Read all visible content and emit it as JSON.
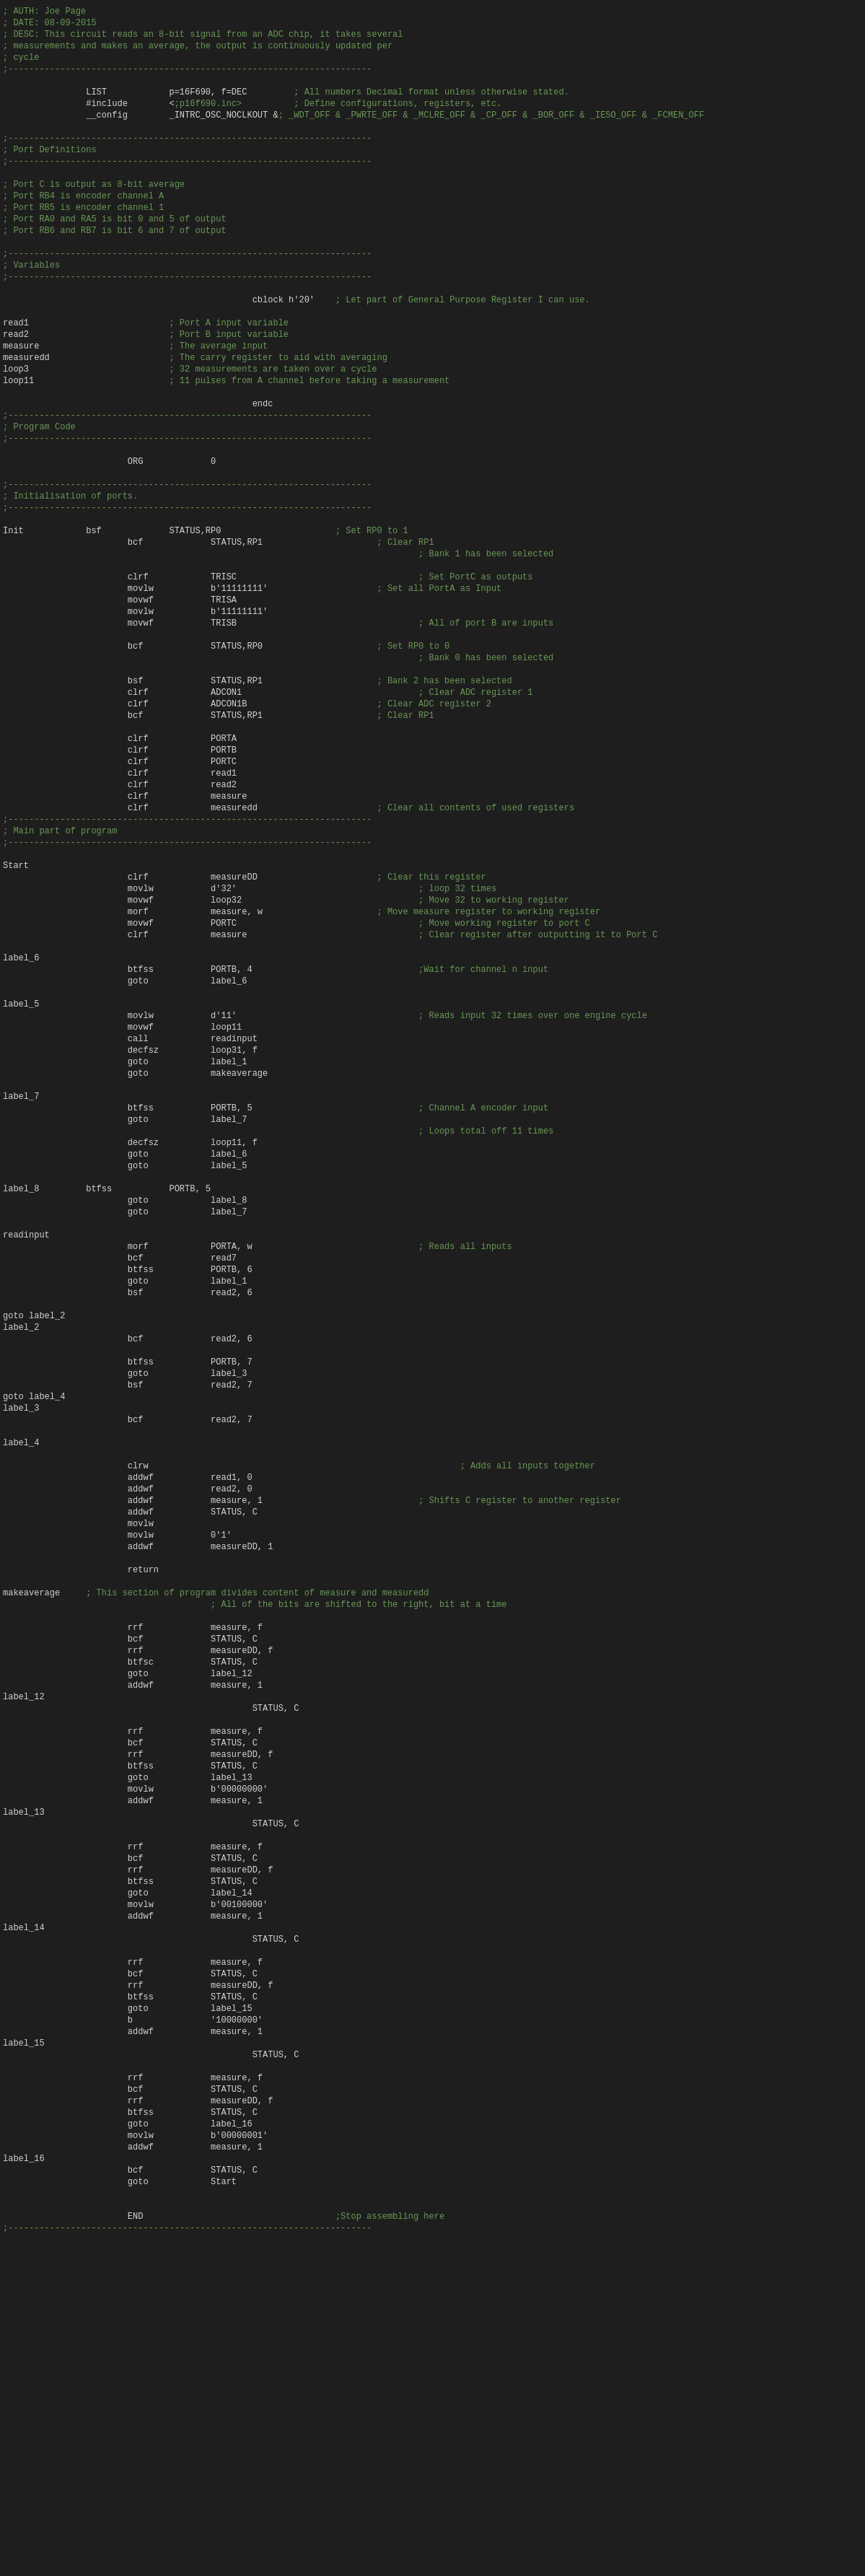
{
  "lines": [
    {
      "num": "",
      "content": "; AUTH: Joe Page",
      "class": "comment"
    },
    {
      "num": "",
      "content": "; DATE: 08-09-2015",
      "class": "comment"
    },
    {
      "num": "",
      "content": "; DESC: This circuit reads an 8-bit signal from an ADC chip, it takes several",
      "class": "comment"
    },
    {
      "num": "",
      "content": "; measurements and makes an average, the output is continuously updated per",
      "class": "comment"
    },
    {
      "num": "",
      "content": "; cycle",
      "class": "comment"
    },
    {
      "num": "",
      "content": ";----------------------------------------------------------------------",
      "class": "separator"
    },
    {
      "num": "",
      "content": "",
      "class": "normal"
    },
    {
      "num": "",
      "content": "\t\tLIST\t\tp=16F690, f=DEC\t\t; All numbers Decimal format unless otherwise stated.",
      "class": "normal"
    },
    {
      "num": "",
      "content": "\t\t#include\t<p16f690.inc>\t\t; Define configurations, registers, etc.",
      "class": "normal"
    },
    {
      "num": "",
      "content": "\t\t__config\t_INTRC_OSC_NOCLKOUT & _WDT_OFF & _PWRTE_OFF & _MCLRE_OFF & _CP_OFF & _BOR_OFF & _IESO_OFF & _FCMEN_OFF",
      "class": "normal"
    },
    {
      "num": "",
      "content": "",
      "class": "normal"
    },
    {
      "num": "",
      "content": ";----------------------------------------------------------------------",
      "class": "separator"
    },
    {
      "num": "",
      "content": "; Port Definitions",
      "class": "comment"
    },
    {
      "num": "",
      "content": ";----------------------------------------------------------------------",
      "class": "separator"
    },
    {
      "num": "",
      "content": "",
      "class": "normal"
    },
    {
      "num": "",
      "content": "; Port C is output as 8-bit average",
      "class": "comment"
    },
    {
      "num": "",
      "content": "; Port RB4 is encoder channel A",
      "class": "comment"
    },
    {
      "num": "",
      "content": "; Port RB5 is encoder channel 1",
      "class": "comment"
    },
    {
      "num": "",
      "content": "; Port RA0 and RA5 is bit 0 and 5 of output",
      "class": "comment"
    },
    {
      "num": "",
      "content": "; Port RB6 and RB7 is bit 6 and 7 of output",
      "class": "comment"
    },
    {
      "num": "",
      "content": "",
      "class": "normal"
    },
    {
      "num": "",
      "content": ";----------------------------------------------------------------------",
      "class": "separator"
    },
    {
      "num": "",
      "content": "; Variables",
      "class": "comment"
    },
    {
      "num": "",
      "content": ";----------------------------------------------------------------------",
      "class": "separator"
    },
    {
      "num": "",
      "content": "",
      "class": "normal"
    },
    {
      "num": "",
      "content": "\t\t\t\t\t\tcblock h'20'\t; Let part of General Purpose Register I can use.",
      "class": "normal"
    },
    {
      "num": "",
      "content": "",
      "class": "normal"
    },
    {
      "num": "",
      "content": "read1\t\t\t\t; Port A input variable",
      "class": "normal"
    },
    {
      "num": "",
      "content": "read2\t\t\t\t; Port B input variable",
      "class": "normal"
    },
    {
      "num": "",
      "content": "measure\t\t\t\t; The average input",
      "class": "normal"
    },
    {
      "num": "",
      "content": "measuredd\t\t\t; The carry register to aid with averaging",
      "class": "normal"
    },
    {
      "num": "",
      "content": "loop3\t\t\t\t; 32 measurements are taken over a cycle",
      "class": "normal"
    },
    {
      "num": "",
      "content": "loop11\t\t\t\t; 11 pulses from A channel before taking a measurement",
      "class": "normal"
    },
    {
      "num": "",
      "content": "",
      "class": "normal"
    },
    {
      "num": "",
      "content": "\t\t\t\t\t\tendc",
      "class": "normal"
    },
    {
      "num": "",
      "content": ";----------------------------------------------------------------------",
      "class": "separator"
    },
    {
      "num": "",
      "content": "; Program Code",
      "class": "comment"
    },
    {
      "num": "",
      "content": ";----------------------------------------------------------------------",
      "class": "separator"
    },
    {
      "num": "",
      "content": "",
      "class": "normal"
    },
    {
      "num": "",
      "content": "\t\t\tORG\t\t0",
      "class": "normal"
    },
    {
      "num": "",
      "content": "",
      "class": "normal"
    },
    {
      "num": "",
      "content": ";----------------------------------------------------------------------",
      "class": "separator"
    },
    {
      "num": "",
      "content": "; Initialisation of ports.",
      "class": "comment"
    },
    {
      "num": "",
      "content": ";----------------------------------------------------------------------",
      "class": "separator"
    },
    {
      "num": "",
      "content": "",
      "class": "normal"
    },
    {
      "num": "",
      "content": "Init\t\tbsf\t\tSTATUS,RP0\t\t\t; Set RP0 to 1",
      "class": "normal"
    },
    {
      "num": "",
      "content": "\t\t\tbcf\t\tSTATUS,RP1\t\t\t; Clear RP1",
      "class": "normal"
    },
    {
      "num": "",
      "content": "\t\t\t\t\t\t\t\t\t\t; Bank 1 has been selected",
      "class": "comment"
    },
    {
      "num": "",
      "content": "",
      "class": "normal"
    },
    {
      "num": "",
      "content": "\t\t\tclrf\t\tTRISC\t\t\t\t\t; Set PortC as outputs",
      "class": "normal"
    },
    {
      "num": "",
      "content": "\t\t\tmovlw\t\tb'11111111'\t\t\t; Set all PortA as Input",
      "class": "normal"
    },
    {
      "num": "",
      "content": "\t\t\tmovwf\t\tTRISA\t",
      "class": "normal"
    },
    {
      "num": "",
      "content": "\t\t\tmovlw\t\tb'11111111'\t",
      "class": "normal"
    },
    {
      "num": "",
      "content": "\t\t\tmovwf\t\tTRISB\t\t\t\t\t; All of port B are inputs",
      "class": "normal"
    },
    {
      "num": "",
      "content": "",
      "class": "normal"
    },
    {
      "num": "",
      "content": "\t\t\tbcf\t\tSTATUS,RP0\t\t\t; Set RP0 to 0",
      "class": "normal"
    },
    {
      "num": "",
      "content": "\t\t\t\t\t\t\t\t\t\t; Bank 0 has been selected",
      "class": "comment"
    },
    {
      "num": "",
      "content": "",
      "class": "normal"
    },
    {
      "num": "",
      "content": "\t\t\tbsf\t\tSTATUS,RP1\t\t\t; Bank 2 has been selected",
      "class": "normal"
    },
    {
      "num": "",
      "content": "\t\t\tclrf\t\tADCON1\t\t\t\t\t; Clear ADC register 1",
      "class": "normal"
    },
    {
      "num": "",
      "content": "\t\t\tclrf\t\tADCON1B\t\t\t\t; Clear ADC register 2",
      "class": "normal"
    },
    {
      "num": "",
      "content": "\t\t\tbcf\t\tSTATUS,RP1\t\t\t; Clear RP1",
      "class": "normal"
    },
    {
      "num": "",
      "content": "",
      "class": "normal"
    },
    {
      "num": "",
      "content": "\t\t\tclrf\t\tPORTA",
      "class": "normal"
    },
    {
      "num": "",
      "content": "\t\t\tclrf\t\tPORTB",
      "class": "normal"
    },
    {
      "num": "",
      "content": "\t\t\tclrf\t\tPORTC",
      "class": "normal"
    },
    {
      "num": "",
      "content": "\t\t\tclrf\t\tread1",
      "class": "normal"
    },
    {
      "num": "",
      "content": "\t\t\tclrf\t\tread2",
      "class": "normal"
    },
    {
      "num": "",
      "content": "\t\t\tclrf\t\tmeasure",
      "class": "normal"
    },
    {
      "num": "",
      "content": "\t\t\tclrf\t\tmeasuredd\t\t\t; Clear all contents of used registers",
      "class": "normal"
    },
    {
      "num": "",
      "content": ";----------------------------------------------------------------------",
      "class": "separator"
    },
    {
      "num": "",
      "content": "; Main part of program",
      "class": "comment"
    },
    {
      "num": "",
      "content": ";----------------------------------------------------------------------",
      "class": "separator"
    },
    {
      "num": "",
      "content": "",
      "class": "normal"
    },
    {
      "num": "",
      "content": "Start",
      "class": "label"
    },
    {
      "num": "",
      "content": "\t\t\tclrf\t\tmeasureDD\t\t\t; Clear this register",
      "class": "normal"
    },
    {
      "num": "",
      "content": "\t\t\tmovlw\t\td'32'\t\t\t\t\t; loop 32 times",
      "class": "normal"
    },
    {
      "num": "",
      "content": "\t\t\tmovwf\t\tloop32\t\t\t\t\t; Move 32 to working register",
      "class": "normal"
    },
    {
      "num": "",
      "content": "\t\t\tmorf\t\tmeasure, w\t\t\t; Move measure register to working register",
      "class": "normal"
    },
    {
      "num": "",
      "content": "\t\t\tmovwf\t\tPORTC\t\t\t\t\t; Move working register to port C",
      "class": "normal"
    },
    {
      "num": "",
      "content": "\t\t\tclrf\t\tmeasure\t\t\t\t\t; Clear register after outputting it to Port C",
      "class": "normal"
    },
    {
      "num": "",
      "content": "",
      "class": "normal"
    },
    {
      "num": "",
      "content": "label_6",
      "class": "label"
    },
    {
      "num": "",
      "content": "\t\t\tbtfss\t\tPORTB, 4\t\t\t\t;Wait for channel n input",
      "class": "normal"
    },
    {
      "num": "",
      "content": "\t\t\tgoto\t\tlabel_6",
      "class": "normal"
    },
    {
      "num": "",
      "content": "",
      "class": "normal"
    },
    {
      "num": "",
      "content": "label_5",
      "class": "label"
    },
    {
      "num": "",
      "content": "\t\t\tmovlw\t\td'11'\t\t\t\t\t; Reads input 32 times over one engine cycle",
      "class": "normal"
    },
    {
      "num": "",
      "content": "\t\t\tmovwf\t\tloop11",
      "class": "normal"
    },
    {
      "num": "",
      "content": "\t\t\tcall\t\treadinput",
      "class": "normal"
    },
    {
      "num": "",
      "content": "\t\t\tdecfsz\t\tloop31, f",
      "class": "normal"
    },
    {
      "num": "",
      "content": "\t\t\tgoto\t\tlabel_1",
      "class": "normal"
    },
    {
      "num": "",
      "content": "\t\t\tgoto\t\tmakeaverage",
      "class": "normal"
    },
    {
      "num": "",
      "content": "",
      "class": "normal"
    },
    {
      "num": "",
      "content": "label_7",
      "class": "label"
    },
    {
      "num": "",
      "content": "\t\t\tbtfss\t\tPORTB, 5\t\t\t\t; Channel A encoder input",
      "class": "normal"
    },
    {
      "num": "",
      "content": "\t\t\tgoto\t\tlabel_7",
      "class": "normal"
    },
    {
      "num": "",
      "content": "\t\t\t\t\t\t\t\t\t\t; Loops total off 11 times",
      "class": "comment"
    },
    {
      "num": "",
      "content": "\t\t\tdecfsz\t\tloop11, f",
      "class": "normal"
    },
    {
      "num": "",
      "content": "\t\t\tgoto\t\tlabel_6",
      "class": "normal"
    },
    {
      "num": "",
      "content": "\t\t\tgoto\t\tlabel_5",
      "class": "normal"
    },
    {
      "num": "",
      "content": "",
      "class": "normal"
    },
    {
      "num": "",
      "content": "label_8\t\tbtfss\t\tPORTB, 5",
      "class": "normal"
    },
    {
      "num": "",
      "content": "\t\t\tgoto\t\tlabel_8",
      "class": "normal"
    },
    {
      "num": "",
      "content": "\t\t\tgoto\t\tlabel_7",
      "class": "normal"
    },
    {
      "num": "",
      "content": "",
      "class": "normal"
    },
    {
      "num": "",
      "content": "readinput",
      "class": "label"
    },
    {
      "num": "",
      "content": "\t\t\tmorf\t\tPORTA, w\t\t\t\t; Reads all inputs",
      "class": "normal"
    },
    {
      "num": "",
      "content": "\t\t\tbcf\t\tread7",
      "class": "normal"
    },
    {
      "num": "",
      "content": "\t\t\tbtfss\t\tPORTB, 6",
      "class": "normal"
    },
    {
      "num": "",
      "content": "\t\t\tgoto\t\tlabel_1",
      "class": "normal"
    },
    {
      "num": "",
      "content": "\t\t\tbsf\t\tread2, 6",
      "class": "normal"
    },
    {
      "num": "",
      "content": "",
      "class": "normal"
    },
    {
      "num": "",
      "content": "goto label_2",
      "class": "normal"
    },
    {
      "num": "",
      "content": "label_2",
      "class": "label"
    },
    {
      "num": "",
      "content": "\t\t\tbcf\t\tread2, 6",
      "class": "normal"
    },
    {
      "num": "",
      "content": "",
      "class": "normal"
    },
    {
      "num": "",
      "content": "\t\t\tbtfss\t\tPORTB, 7",
      "class": "normal"
    },
    {
      "num": "",
      "content": "\t\t\tgoto\t\tlabel_3",
      "class": "normal"
    },
    {
      "num": "",
      "content": "\t\t\tbsf\t\tread2, 7",
      "class": "normal"
    },
    {
      "num": "",
      "content": "goto label_4",
      "class": "normal"
    },
    {
      "num": "",
      "content": "label_3",
      "class": "label"
    },
    {
      "num": "",
      "content": "\t\t\tbcf\t\tread2, 7",
      "class": "normal"
    },
    {
      "num": "",
      "content": "",
      "class": "normal"
    },
    {
      "num": "",
      "content": "label_4",
      "class": "label"
    },
    {
      "num": "",
      "content": "",
      "class": "normal"
    },
    {
      "num": "",
      "content": "\t\t\tclrw\t\t\t\t\t\t\t\t; Adds all inputs together",
      "class": "normal"
    },
    {
      "num": "",
      "content": "\t\t\taddwf\t\tread1, 0",
      "class": "normal"
    },
    {
      "num": "",
      "content": "\t\t\taddwf\t\tread2, 0",
      "class": "normal"
    },
    {
      "num": "",
      "content": "\t\t\taddwf\t\tmeasure, 1\t\t\t\t; Shifts C register to another register",
      "class": "normal"
    },
    {
      "num": "",
      "content": "\t\t\taddwf\t\tSTATUS, C",
      "class": "normal"
    },
    {
      "num": "",
      "content": "\t\t\tmovlw",
      "class": "normal"
    },
    {
      "num": "",
      "content": "\t\t\tmovlw\t\t0'1'",
      "class": "normal"
    },
    {
      "num": "",
      "content": "\t\t\taddwf\t\tmeasureDD, 1",
      "class": "normal"
    },
    {
      "num": "",
      "content": "",
      "class": "normal"
    },
    {
      "num": "",
      "content": "\t\t\treturn",
      "class": "normal"
    },
    {
      "num": "",
      "content": "",
      "class": "normal"
    },
    {
      "num": "",
      "content": "makeaverage\t; This section of program divides content of measure and measuredd",
      "class": "normal"
    },
    {
      "num": "",
      "content": "\t\t\t\t\t; All of the bits are shifted to the right, bit at a time",
      "class": "comment"
    },
    {
      "num": "",
      "content": "",
      "class": "normal"
    },
    {
      "num": "",
      "content": "\t\t\trrf\t\tmeasure, f",
      "class": "normal"
    },
    {
      "num": "",
      "content": "\t\t\tbcf\t\tSTATUS, C",
      "class": "normal"
    },
    {
      "num": "",
      "content": "\t\t\trrf\t\tmeasureDD, f",
      "class": "normal"
    },
    {
      "num": "",
      "content": "\t\t\tbtfsc\t\tSTATUS, C",
      "class": "normal"
    },
    {
      "num": "",
      "content": "\t\t\tgoto\t\tlabel_12",
      "class": "normal"
    },
    {
      "num": "",
      "content": "\t\t\taddwf\t\tmeasure, 1",
      "class": "normal"
    },
    {
      "num": "",
      "content": "label_12",
      "class": "label"
    },
    {
      "num": "",
      "content": "\t\t\t\t\t\tSTATUS, C",
      "class": "normal"
    },
    {
      "num": "",
      "content": "",
      "class": "normal"
    },
    {
      "num": "",
      "content": "\t\t\trrf\t\tmeasure, f",
      "class": "normal"
    },
    {
      "num": "",
      "content": "\t\t\tbcf\t\tSTATUS, C",
      "class": "normal"
    },
    {
      "num": "",
      "content": "\t\t\trrf\t\tmeasureDD, f",
      "class": "normal"
    },
    {
      "num": "",
      "content": "\t\t\tbtfss\t\tSTATUS, C",
      "class": "normal"
    },
    {
      "num": "",
      "content": "\t\t\tgoto\t\tlabel_13",
      "class": "normal"
    },
    {
      "num": "",
      "content": "\t\t\tmovlw\t\tb'00000000'",
      "class": "normal"
    },
    {
      "num": "",
      "content": "\t\t\taddwf\t\tmeasure, 1",
      "class": "normal"
    },
    {
      "num": "",
      "content": "label_13",
      "class": "label"
    },
    {
      "num": "",
      "content": "\t\t\t\t\t\tSTATUS, C",
      "class": "normal"
    },
    {
      "num": "",
      "content": "",
      "class": "normal"
    },
    {
      "num": "",
      "content": "\t\t\trrf\t\tmeasure, f",
      "class": "normal"
    },
    {
      "num": "",
      "content": "\t\t\tbcf\t\tSTATUS, C",
      "class": "normal"
    },
    {
      "num": "",
      "content": "\t\t\trrf\t\tmeasureDD, f",
      "class": "normal"
    },
    {
      "num": "",
      "content": "\t\t\tbtfss\t\tSTATUS, C",
      "class": "normal"
    },
    {
      "num": "",
      "content": "\t\t\tgoto\t\tlabel_14",
      "class": "normal"
    },
    {
      "num": "",
      "content": "\t\t\tmovlw\t\tb'00100000'",
      "class": "normal"
    },
    {
      "num": "",
      "content": "\t\t\taddwf\t\tmeasure, 1",
      "class": "normal"
    },
    {
      "num": "",
      "content": "label_14",
      "class": "label"
    },
    {
      "num": "",
      "content": "\t\t\t\t\t\tSTATUS, C",
      "class": "normal"
    },
    {
      "num": "",
      "content": "",
      "class": "normal"
    },
    {
      "num": "",
      "content": "\t\t\trrf\t\tmeasure, f",
      "class": "normal"
    },
    {
      "num": "",
      "content": "\t\t\tbcf\t\tSTATUS, C",
      "class": "normal"
    },
    {
      "num": "",
      "content": "\t\t\trrf\t\tmeasureDD, f",
      "class": "normal"
    },
    {
      "num": "",
      "content": "\t\t\tbtfss\t\tSTATUS, C",
      "class": "normal"
    },
    {
      "num": "",
      "content": "\t\t\tgoto\t\tlabel_15",
      "class": "normal"
    },
    {
      "num": "",
      "content": "\t\t\tb\t\t'10000000'",
      "class": "normal"
    },
    {
      "num": "",
      "content": "\t\t\taddwf\t\tmeasure, 1",
      "class": "normal"
    },
    {
      "num": "",
      "content": "label_15",
      "class": "label"
    },
    {
      "num": "",
      "content": "\t\t\t\t\t\tSTATUS, C",
      "class": "normal"
    },
    {
      "num": "",
      "content": "",
      "class": "normal"
    },
    {
      "num": "",
      "content": "\t\t\trrf\t\tmeasure, f",
      "class": "normal"
    },
    {
      "num": "",
      "content": "\t\t\tbcf\t\tSTATUS, C",
      "class": "normal"
    },
    {
      "num": "",
      "content": "\t\t\trrf\t\tmeasureDD, f",
      "class": "normal"
    },
    {
      "num": "",
      "content": "\t\t\tbtfss\t\tSTATUS, C",
      "class": "normal"
    },
    {
      "num": "",
      "content": "\t\t\tgoto\t\tlabel_16",
      "class": "normal"
    },
    {
      "num": "",
      "content": "\t\t\tmovlw\t\tb'00000001'",
      "class": "normal"
    },
    {
      "num": "",
      "content": "\t\t\taddwf\t\tmeasure, 1",
      "class": "normal"
    },
    {
      "num": "",
      "content": "label_16",
      "class": "label"
    },
    {
      "num": "",
      "content": "\t\t\tbcf\t\tSTATUS, C",
      "class": "normal"
    },
    {
      "num": "",
      "content": "\t\t\tgoto\t\tStart",
      "class": "normal"
    },
    {
      "num": "",
      "content": "",
      "class": "normal"
    },
    {
      "num": "",
      "content": "",
      "class": "normal"
    },
    {
      "num": "",
      "content": "\t\t\tEND\t\t\t\t\t;Stop assembling here",
      "class": "normal"
    },
    {
      "num": "",
      "content": ";----------------------------------------------------------------------",
      "class": "separator"
    }
  ]
}
